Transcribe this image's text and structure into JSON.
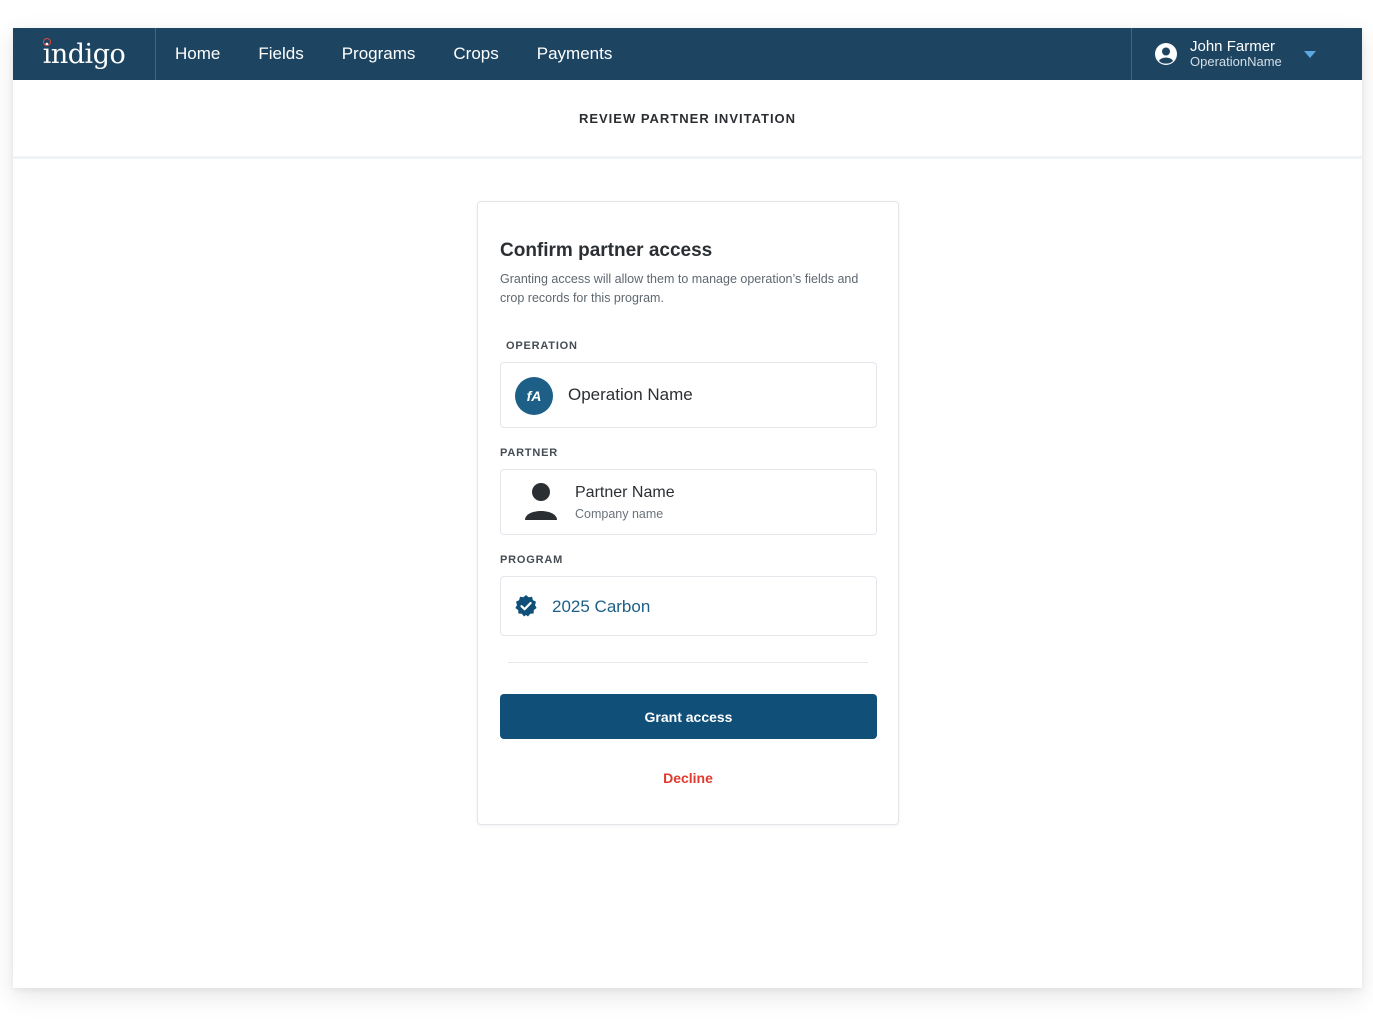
{
  "brand": {
    "logo_text": "indigo",
    "accent": "#e4473a",
    "nav_bg": "#1d4562"
  },
  "nav": {
    "items": [
      {
        "label": "Home"
      },
      {
        "label": "Fields"
      },
      {
        "label": "Programs"
      },
      {
        "label": "Crops"
      },
      {
        "label": "Payments"
      }
    ]
  },
  "user": {
    "name": "John Farmer",
    "operation": "OperationName",
    "icon": "user-circle-icon"
  },
  "page": {
    "title": "REVIEW PARTNER INVITATION"
  },
  "card": {
    "title": "Confirm partner access",
    "description": "Granting access will allow them to manage operation’s fields and crop records for this program.",
    "operation": {
      "label": "OPERATION",
      "name": "Operation Name",
      "avatar_text": "fA"
    },
    "partner": {
      "label": "PARTNER",
      "name": "Partner Name",
      "company": "Company name",
      "icon": "person-icon"
    },
    "program": {
      "label": "PROGRAM",
      "name": "2025 Carbon",
      "icon": "verified-badge-icon"
    },
    "grant_label": "Grant access",
    "decline_label": "Decline",
    "primary_color": "#0f4f78",
    "danger_color": "#e03a2f"
  }
}
